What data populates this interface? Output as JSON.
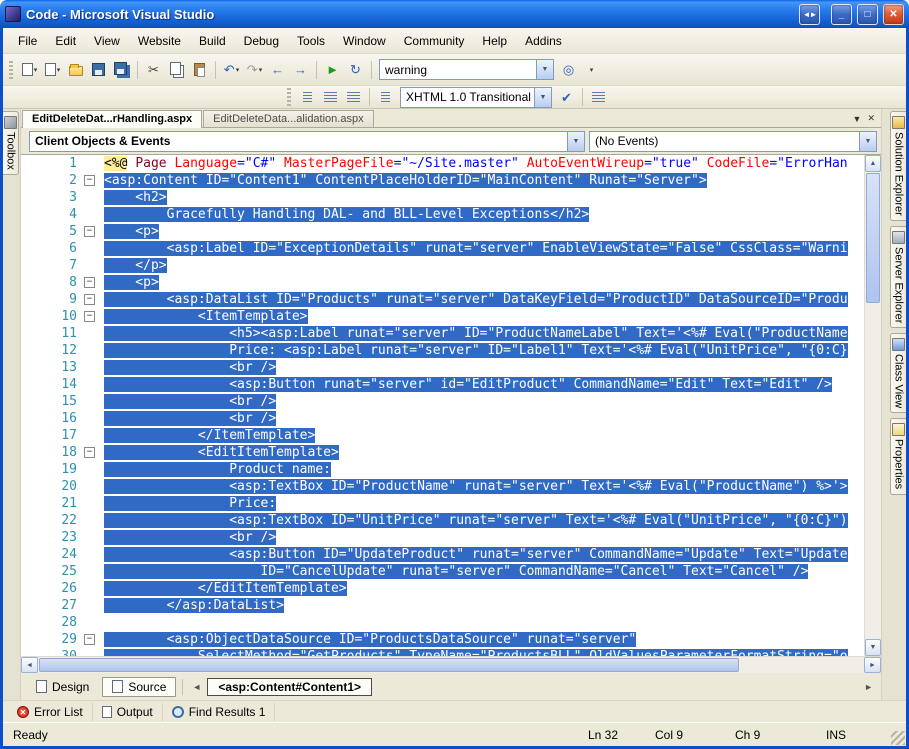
{
  "window": {
    "title": "Code - Microsoft Visual Studio"
  },
  "titlebar": {
    "float_btn": "◄►",
    "minimize_btn": "_",
    "maximize_btn": "□",
    "close_btn": "✕"
  },
  "menu": {
    "items": [
      "File",
      "Edit",
      "View",
      "Website",
      "Build",
      "Debug",
      "Tools",
      "Window",
      "Community",
      "Help",
      "Addins"
    ]
  },
  "toolbar": {
    "find_text": "warning",
    "doctype_text": "XHTML 1.0 Transitional ("
  },
  "icons": {
    "cut": "✂",
    "undo": "↶",
    "redo": "↷",
    "back": "←",
    "forward": "→",
    "play": "►",
    "refresh": "↻",
    "check": "✔",
    "find": "◎",
    "caret": "▼",
    "overflow": "▾",
    "tab_dropdown": "▼",
    "tab_close": "✕",
    "scroll_up": "▲",
    "scroll_down": "▼",
    "scroll_left": "◄",
    "scroll_right": "►",
    "error": "✕"
  },
  "doc_tabs": {
    "tab1": "EditDeleteDat...rHandling.aspx",
    "tab2": "EditDeleteData...alidation.aspx"
  },
  "navbar": {
    "objects": "Client Objects & Events",
    "events": "(No Events)"
  },
  "editor": {
    "lines": [
      {
        "n": 1,
        "s": false,
        "f": false,
        "seg": [
          {
            "c": "dir",
            "t": "<%@"
          },
          {
            "c": "plain",
            "t": " "
          },
          {
            "c": "tag",
            "t": "Page"
          },
          {
            "c": "plain",
            "t": " "
          },
          {
            "c": "attr",
            "t": "Language"
          },
          {
            "c": "op",
            "t": "="
          },
          {
            "c": "val",
            "t": "\"C#\""
          },
          {
            "c": "plain",
            "t": " "
          },
          {
            "c": "attr",
            "t": "MasterPageFile"
          },
          {
            "c": "op",
            "t": "="
          },
          {
            "c": "val",
            "t": "\"~/Site.master\""
          },
          {
            "c": "plain",
            "t": " "
          },
          {
            "c": "attr",
            "t": "AutoEventWireup"
          },
          {
            "c": "op",
            "t": "="
          },
          {
            "c": "val",
            "t": "\"true\""
          },
          {
            "c": "plain",
            "t": " "
          },
          {
            "c": "attr",
            "t": "CodeFile"
          },
          {
            "c": "op",
            "t": "="
          },
          {
            "c": "val",
            "t": "\"ErrorHan"
          }
        ]
      },
      {
        "n": 2,
        "s": true,
        "f": true,
        "t": "<asp:Content ID=\"Content1\" ContentPlaceHolderID=\"MainContent\" Runat=\"Server\">"
      },
      {
        "n": 3,
        "s": true,
        "f": false,
        "t": "    <h2>"
      },
      {
        "n": 4,
        "s": true,
        "f": false,
        "t": "        Gracefully Handling DAL- and BLL-Level Exceptions</h2>"
      },
      {
        "n": 5,
        "s": true,
        "f": true,
        "t": "    <p>"
      },
      {
        "n": 6,
        "s": true,
        "f": false,
        "t": "        <asp:Label ID=\"ExceptionDetails\" runat=\"server\" EnableViewState=\"False\" CssClass=\"Warni"
      },
      {
        "n": 7,
        "s": true,
        "f": false,
        "t": "    </p>"
      },
      {
        "n": 8,
        "s": true,
        "f": true,
        "t": "    <p>"
      },
      {
        "n": 9,
        "s": true,
        "f": true,
        "t": "        <asp:DataList ID=\"Products\" runat=\"server\" DataKeyField=\"ProductID\" DataSourceID=\"Produ"
      },
      {
        "n": 10,
        "s": true,
        "f": true,
        "t": "            <ItemTemplate>"
      },
      {
        "n": 11,
        "s": true,
        "f": false,
        "t": "                <h5><asp:Label runat=\"server\" ID=\"ProductNameLabel\" Text='<%# Eval(\"ProductName"
      },
      {
        "n": 12,
        "s": true,
        "f": false,
        "t": "                Price: <asp:Label runat=\"server\" ID=\"Label1\" Text='<%# Eval(\"UnitPrice\", \"{0:C}"
      },
      {
        "n": 13,
        "s": true,
        "f": false,
        "t": "                <br />"
      },
      {
        "n": 14,
        "s": true,
        "f": false,
        "t": "                <asp:Button runat=\"server\" id=\"EditProduct\" CommandName=\"Edit\" Text=\"Edit\" />"
      },
      {
        "n": 15,
        "s": true,
        "f": false,
        "t": "                <br />"
      },
      {
        "n": 16,
        "s": true,
        "f": false,
        "t": "                <br />"
      },
      {
        "n": 17,
        "s": true,
        "f": false,
        "t": "            </ItemTemplate>"
      },
      {
        "n": 18,
        "s": true,
        "f": true,
        "t": "            <EditItemTemplate>"
      },
      {
        "n": 19,
        "s": true,
        "f": false,
        "t": "                Product name:"
      },
      {
        "n": 20,
        "s": true,
        "f": false,
        "t": "                <asp:TextBox ID=\"ProductName\" runat=\"server\" Text='<%# Eval(\"ProductName\") %>'>"
      },
      {
        "n": 21,
        "s": true,
        "f": false,
        "t": "                Price:"
      },
      {
        "n": 22,
        "s": true,
        "f": false,
        "t": "                <asp:TextBox ID=\"UnitPrice\" runat=\"server\" Text='<%# Eval(\"UnitPrice\", \"{0:C}\")"
      },
      {
        "n": 23,
        "s": true,
        "f": false,
        "t": "                <br />"
      },
      {
        "n": 24,
        "s": true,
        "f": false,
        "t": "                <asp:Button ID=\"UpdateProduct\" runat=\"server\" CommandName=\"Update\" Text=\"Update"
      },
      {
        "n": 25,
        "s": true,
        "f": false,
        "t": "                    ID=\"CancelUpdate\" runat=\"server\" CommandName=\"Cancel\" Text=\"Cancel\" />"
      },
      {
        "n": 26,
        "s": true,
        "f": false,
        "t": "            </EditItemTemplate>"
      },
      {
        "n": 27,
        "s": true,
        "f": false,
        "t": "        </asp:DataList>"
      },
      {
        "n": 28,
        "s": true,
        "f": false,
        "t": ""
      },
      {
        "n": 29,
        "s": true,
        "f": true,
        "t": "        <asp:ObjectDataSource ID=\"ProductsDataSource\" runat=\"server\""
      },
      {
        "n": 30,
        "s": true,
        "f": false,
        "t": "            SelectMethod=\"GetProducts\" TypeName=\"ProductsBLL\" OldValuesParameterFormatString=\"o"
      }
    ]
  },
  "view_bar": {
    "design": "Design",
    "source": "Source",
    "tag": "<asp:Content#Content1>"
  },
  "panel_tabs": {
    "error_list": "Error List",
    "output": "Output",
    "find_results": "Find Results 1"
  },
  "status": {
    "ready": "Ready",
    "ln": "Ln 32",
    "col": "Col 9",
    "ch": "Ch 9",
    "mode": "INS"
  },
  "side_tabs": {
    "toolbox": "Toolbox",
    "solution_explorer": "Solution Explorer",
    "server_explorer": "Server Explorer",
    "class_view": "Class View",
    "properties": "Properties"
  },
  "colors": {
    "selection": "#316ac5",
    "line_number": "#2b91af",
    "titlebar_blue": "#1b6be0",
    "close_red": "#c33a12"
  }
}
